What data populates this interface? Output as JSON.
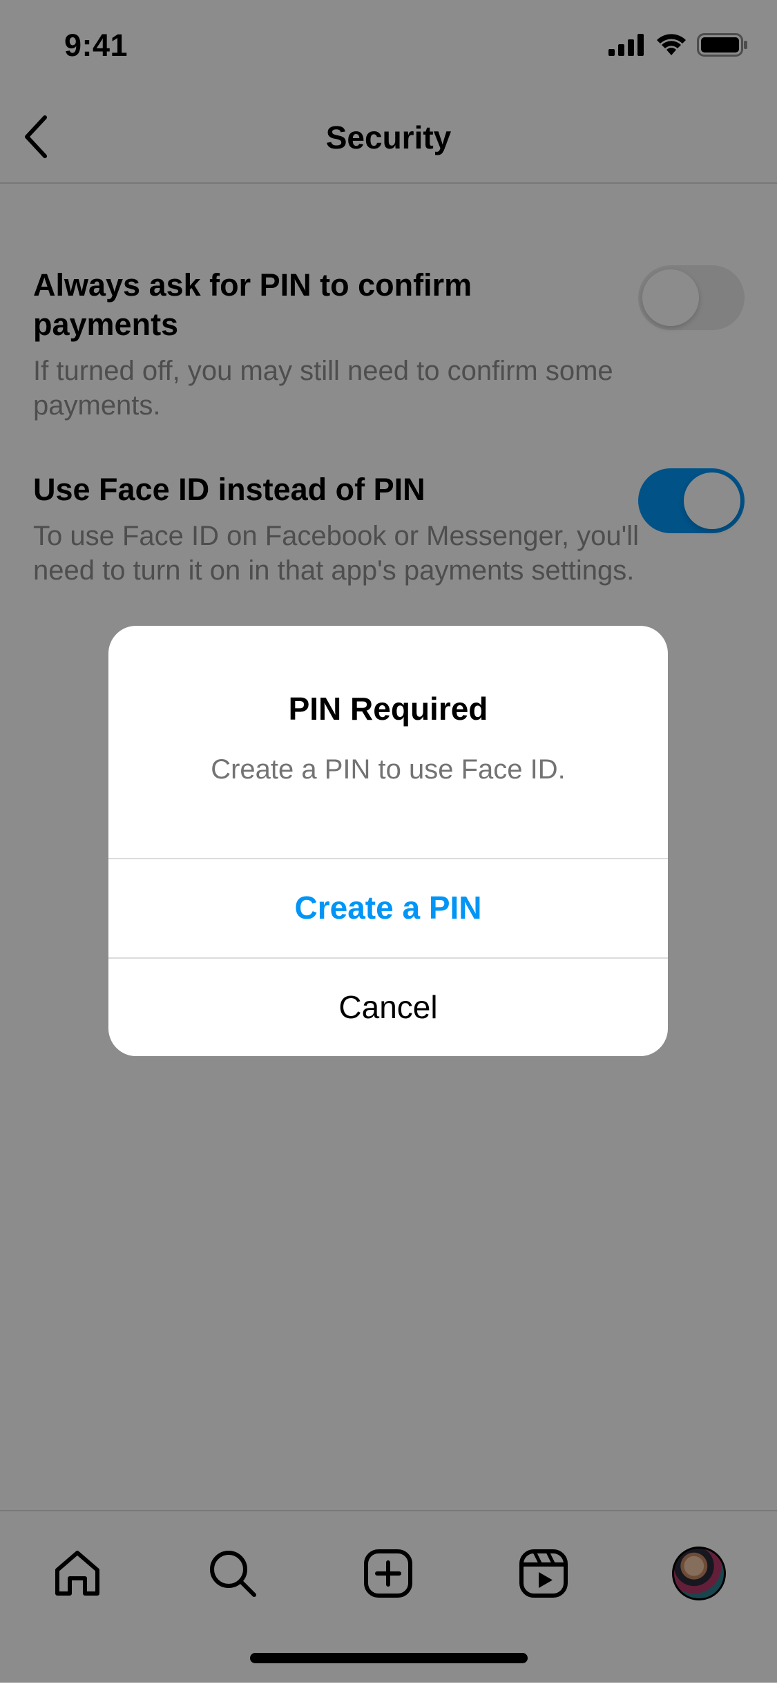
{
  "status_bar": {
    "time": "9:41",
    "icons": [
      "cellular-signal-icon",
      "wifi-icon",
      "battery-icon"
    ]
  },
  "nav": {
    "back_icon": "chevron-left-icon",
    "title": "Security"
  },
  "settings": [
    {
      "title": "Always ask for PIN to confirm payments",
      "description": "If turned off, you may still need to confirm some payments.",
      "toggle_on": false
    },
    {
      "title": "Use Face ID instead of PIN",
      "description": "To use Face ID on Facebook or Messenger, you'll need to turn it on in that app's payments settings.",
      "toggle_on": true
    }
  ],
  "dialog": {
    "title": "PIN Required",
    "message": "Create a PIN to use Face ID.",
    "primary_label": "Create a PIN",
    "secondary_label": "Cancel"
  },
  "tab_bar": {
    "items": [
      "home-icon",
      "search-icon",
      "create-icon",
      "reels-icon",
      "profile-avatar"
    ]
  },
  "colors": {
    "accent": "#0095f6",
    "overlay": "#000000",
    "secondary_text": "#8e8e8e",
    "divider": "#dbdbdb"
  }
}
